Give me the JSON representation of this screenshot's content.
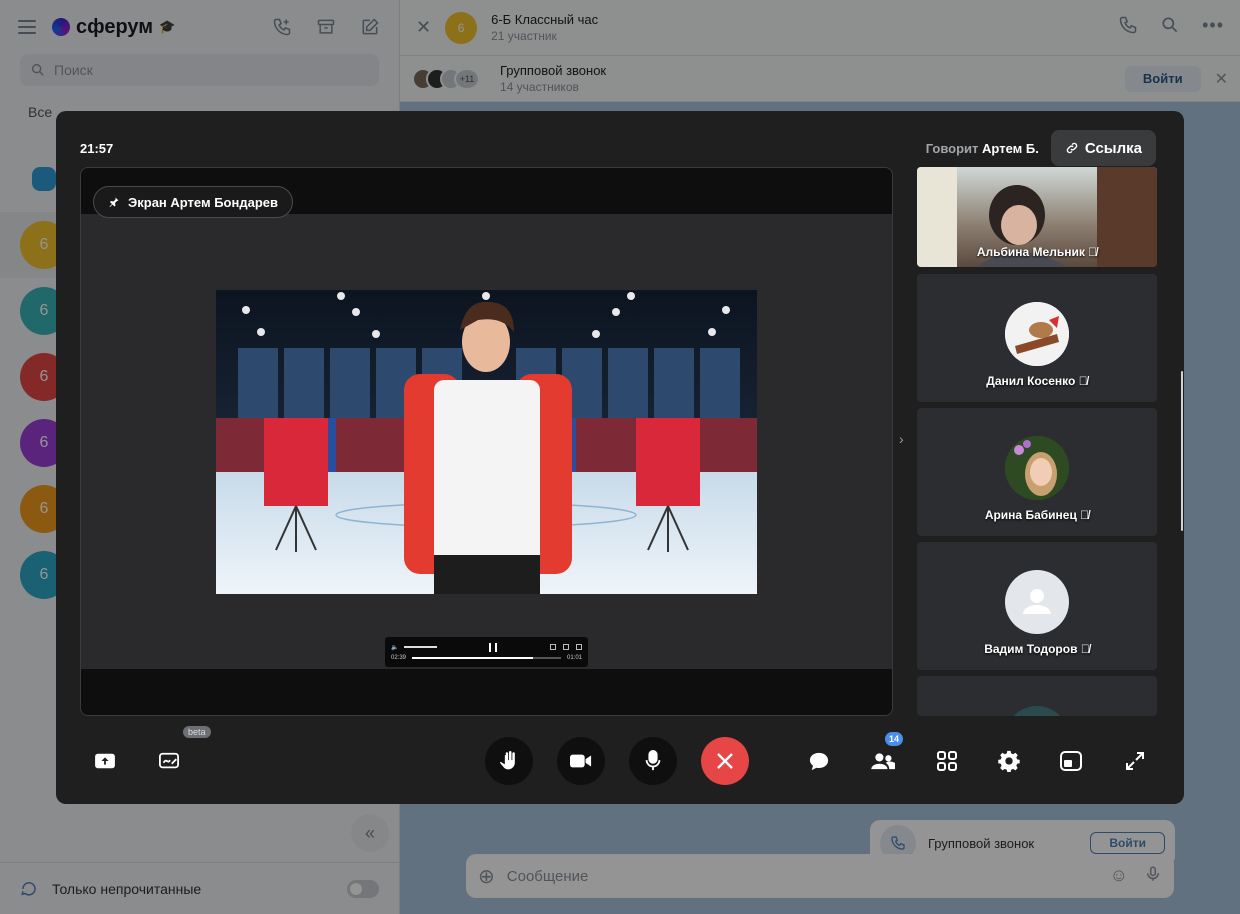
{
  "sidebar": {
    "brand": "сферум",
    "search_placeholder": "Поиск",
    "filter_all": "Все",
    "chat_avatars": [
      "",
      "6",
      "6",
      "6",
      "6",
      "6",
      "6"
    ],
    "only_unread_label": "Только непрочитанные"
  },
  "chat": {
    "title": "6-Б Классный час",
    "subtitle": "21 участник",
    "avatar_text": "6",
    "banner_title": "Групповой звонок",
    "banner_subtitle": "14 участников",
    "banner_more": "+11",
    "join_label": "Войти",
    "card_title": "Групповой звонок",
    "card_join": "Войти",
    "composer_placeholder": "Сообщение"
  },
  "call": {
    "time": "21:57",
    "speaking_prefix": "Говорит",
    "speaking_name": "Артем Б.",
    "link_label": "Ссылка",
    "screen_label": "Экран Артем Бондарев",
    "player": {
      "elapsed": "02:39",
      "remaining": "01:01",
      "progress": 0.81,
      "volume": 0.6
    },
    "participants": [
      {
        "name": "Альбина Мельник",
        "muted": true
      },
      {
        "name": "Данил Косенко",
        "muted": true
      },
      {
        "name": "Арина Бабинец",
        "muted": true
      },
      {
        "name": "Вадим Тодоров",
        "muted": true
      }
    ],
    "beta_label": "beta",
    "participants_count": "14"
  },
  "colors": {
    "end_call": "#e64646",
    "badge": "#4a8eea",
    "call_bg": "#1f1f20",
    "chat_avatars": [
      "#2e9bd6",
      "#f2c12e",
      "#39b3b8",
      "#e64646",
      "#9b3fd6",
      "#f29a1e",
      "#2ea8c6"
    ]
  },
  "icons": {
    "top": [
      "hamburger-icon",
      "new-call-icon",
      "archive-icon",
      "compose-icon"
    ],
    "controls_left": [
      "share-screen-icon",
      "whiteboard-icon"
    ],
    "controls_center": [
      "raise-hand-icon",
      "camera-icon",
      "microphone-icon",
      "end-call-icon"
    ],
    "controls_right": [
      "chat-icon",
      "participants-icon",
      "grid-icon",
      "settings-icon",
      "pip-icon",
      "fullscreen-icon"
    ]
  }
}
